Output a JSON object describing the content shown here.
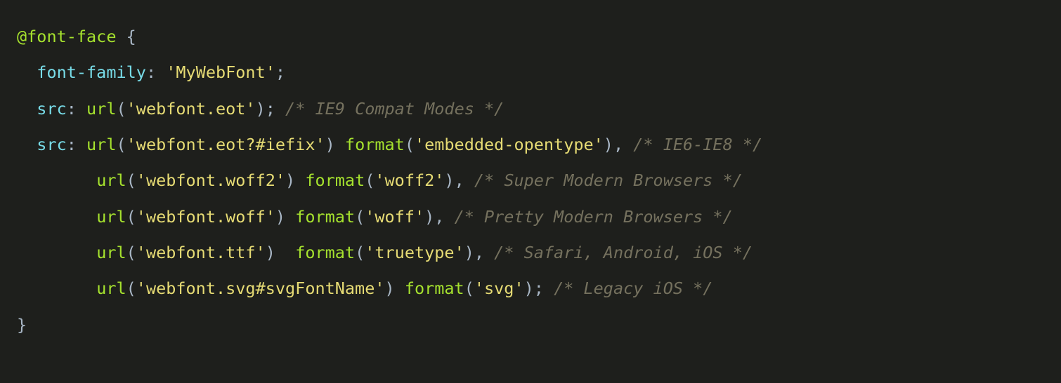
{
  "code": {
    "lines": [
      {
        "indent": 0,
        "tokens": [
          {
            "cls": "tok-atrule",
            "text": "@font-face"
          },
          {
            "cls": "tok-punct",
            "text": " {"
          }
        ]
      },
      {
        "indent": 1,
        "tokens": [
          {
            "cls": "tok-prop",
            "text": "font-family"
          },
          {
            "cls": "tok-punct",
            "text": ": "
          },
          {
            "cls": "tok-str",
            "text": "'MyWebFont'"
          },
          {
            "cls": "tok-punct",
            "text": ";"
          }
        ]
      },
      {
        "indent": 1,
        "tokens": [
          {
            "cls": "tok-prop",
            "text": "src"
          },
          {
            "cls": "tok-punct",
            "text": ": "
          },
          {
            "cls": "tok-func",
            "text": "url"
          },
          {
            "cls": "tok-punct",
            "text": "("
          },
          {
            "cls": "tok-str",
            "text": "'webfont.eot'"
          },
          {
            "cls": "tok-punct",
            "text": "); "
          },
          {
            "cls": "tok-comment",
            "text": "/* IE9 Compat Modes */"
          }
        ]
      },
      {
        "indent": 1,
        "tokens": [
          {
            "cls": "tok-prop",
            "text": "src"
          },
          {
            "cls": "tok-punct",
            "text": ": "
          },
          {
            "cls": "tok-func",
            "text": "url"
          },
          {
            "cls": "tok-punct",
            "text": "("
          },
          {
            "cls": "tok-str",
            "text": "'webfont.eot?#iefix'"
          },
          {
            "cls": "tok-punct",
            "text": ") "
          },
          {
            "cls": "tok-func",
            "text": "format"
          },
          {
            "cls": "tok-punct",
            "text": "("
          },
          {
            "cls": "tok-str",
            "text": "'embedded-opentype'"
          },
          {
            "cls": "tok-punct",
            "text": "), "
          },
          {
            "cls": "tok-comment",
            "text": "/* IE6-IE8 */"
          }
        ]
      },
      {
        "indent": 4,
        "tokens": [
          {
            "cls": "tok-func",
            "text": "url"
          },
          {
            "cls": "tok-punct",
            "text": "("
          },
          {
            "cls": "tok-str",
            "text": "'webfont.woff2'"
          },
          {
            "cls": "tok-punct",
            "text": ") "
          },
          {
            "cls": "tok-func",
            "text": "format"
          },
          {
            "cls": "tok-punct",
            "text": "("
          },
          {
            "cls": "tok-str",
            "text": "'woff2'"
          },
          {
            "cls": "tok-punct",
            "text": "), "
          },
          {
            "cls": "tok-comment",
            "text": "/* Super Modern Browsers */"
          }
        ]
      },
      {
        "indent": 4,
        "tokens": [
          {
            "cls": "tok-func",
            "text": "url"
          },
          {
            "cls": "tok-punct",
            "text": "("
          },
          {
            "cls": "tok-str",
            "text": "'webfont.woff'"
          },
          {
            "cls": "tok-punct",
            "text": ") "
          },
          {
            "cls": "tok-func",
            "text": "format"
          },
          {
            "cls": "tok-punct",
            "text": "("
          },
          {
            "cls": "tok-str",
            "text": "'woff'"
          },
          {
            "cls": "tok-punct",
            "text": "), "
          },
          {
            "cls": "tok-comment",
            "text": "/* Pretty Modern Browsers */"
          }
        ]
      },
      {
        "indent": 4,
        "tokens": [
          {
            "cls": "tok-func",
            "text": "url"
          },
          {
            "cls": "tok-punct",
            "text": "("
          },
          {
            "cls": "tok-str",
            "text": "'webfont.ttf'"
          },
          {
            "cls": "tok-punct",
            "text": ")  "
          },
          {
            "cls": "tok-func",
            "text": "format"
          },
          {
            "cls": "tok-punct",
            "text": "("
          },
          {
            "cls": "tok-str",
            "text": "'truetype'"
          },
          {
            "cls": "tok-punct",
            "text": "), "
          },
          {
            "cls": "tok-comment",
            "text": "/* Safari, Android, iOS */"
          }
        ]
      },
      {
        "indent": 4,
        "tokens": [
          {
            "cls": "tok-func",
            "text": "url"
          },
          {
            "cls": "tok-punct",
            "text": "("
          },
          {
            "cls": "tok-str",
            "text": "'webfont.svg#svgFontName'"
          },
          {
            "cls": "tok-punct",
            "text": ") "
          },
          {
            "cls": "tok-func",
            "text": "format"
          },
          {
            "cls": "tok-punct",
            "text": "("
          },
          {
            "cls": "tok-str",
            "text": "'svg'"
          },
          {
            "cls": "tok-punct",
            "text": "); "
          },
          {
            "cls": "tok-comment",
            "text": "/* Legacy iOS */"
          }
        ]
      },
      {
        "indent": 0,
        "tokens": [
          {
            "cls": "tok-punct",
            "text": "}"
          }
        ]
      }
    ]
  },
  "indent_unit": "  "
}
